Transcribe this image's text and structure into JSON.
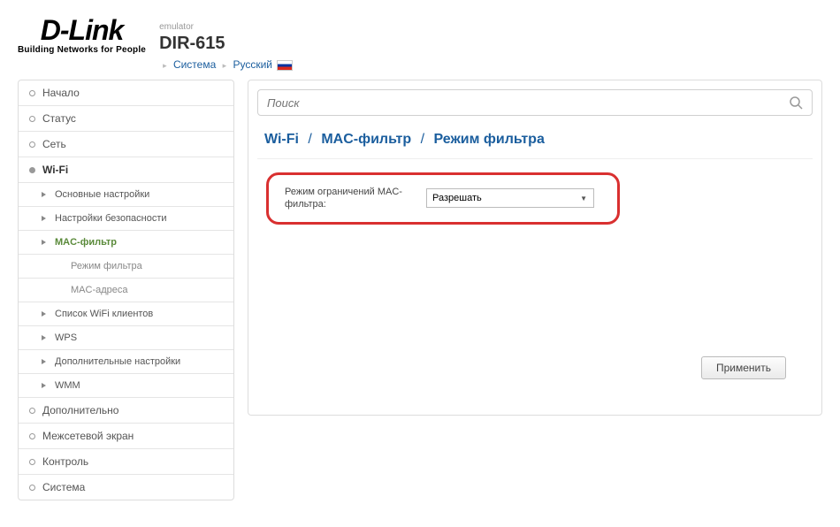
{
  "header": {
    "logo_brand": "D-Link",
    "logo_tagline": "Building Networks for People",
    "emulator": "emulator",
    "model": "DIR-615",
    "system_link": "Система",
    "language_link": "Русский"
  },
  "search": {
    "placeholder": "Поиск"
  },
  "breadcrumb": {
    "part1": "Wi-Fi",
    "part2": "MAC-фильтр",
    "part3": "Режим фильтра",
    "sep": "/"
  },
  "form": {
    "label": "Режим ограничений MAC-фильтра:",
    "value": "Разрешать"
  },
  "buttons": {
    "apply": "Применить"
  },
  "sidebar": {
    "items": [
      {
        "label": "Начало",
        "level": 0,
        "bullet": "circle"
      },
      {
        "label": "Статус",
        "level": 0,
        "bullet": "circle"
      },
      {
        "label": "Сеть",
        "level": 0,
        "bullet": "circle"
      },
      {
        "label": "Wi-Fi",
        "level": 0,
        "bullet": "dot",
        "expanded": true
      },
      {
        "label": "Основные настройки",
        "level": 1,
        "bullet": "chevron"
      },
      {
        "label": "Настройки безопасности",
        "level": 1,
        "bullet": "chevron"
      },
      {
        "label": "MAC-фильтр",
        "level": 1,
        "bullet": "chevron",
        "active": true
      },
      {
        "label": "Режим фильтра",
        "level": 2,
        "bullet": "none"
      },
      {
        "label": "MAC-адреса",
        "level": 2,
        "bullet": "none"
      },
      {
        "label": "Список WiFi клиентов",
        "level": 1,
        "bullet": "chevron"
      },
      {
        "label": "WPS",
        "level": 1,
        "bullet": "chevron"
      },
      {
        "label": "Дополнительные настройки",
        "level": 1,
        "bullet": "chevron"
      },
      {
        "label": "WMM",
        "level": 1,
        "bullet": "chevron"
      },
      {
        "label": "Дополнительно",
        "level": 0,
        "bullet": "circle"
      },
      {
        "label": "Межсетевой экран",
        "level": 0,
        "bullet": "circle"
      },
      {
        "label": "Контроль",
        "level": 0,
        "bullet": "circle"
      },
      {
        "label": "Система",
        "level": 0,
        "bullet": "circle"
      }
    ]
  }
}
